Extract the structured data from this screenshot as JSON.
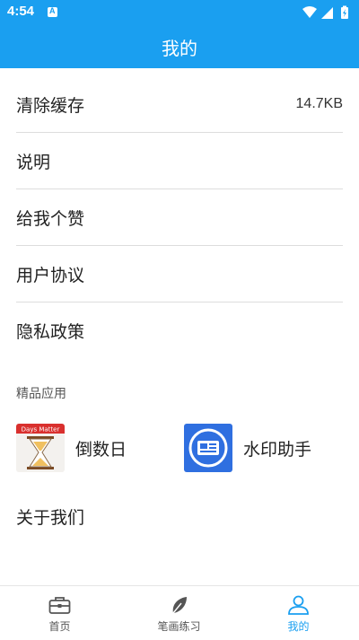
{
  "status_bar": {
    "time": "4:54",
    "notification_icon": "a-icon",
    "system_icons": [
      "wifi-icon",
      "signal-icon",
      "battery-icon"
    ]
  },
  "header": {
    "title": "我的"
  },
  "menu": [
    {
      "label": "清除缓存",
      "value": "14.7KB"
    },
    {
      "label": "说明"
    },
    {
      "label": "给我个赞"
    },
    {
      "label": "用户协议"
    },
    {
      "label": "隐私政策"
    }
  ],
  "featured": {
    "title": "精品应用",
    "apps": [
      {
        "name": "倒数日",
        "icon": "hourglass-icon",
        "icon_text": "Days Matter"
      },
      {
        "name": "水印助手",
        "icon": "watermark-icon"
      }
    ]
  },
  "about": "关于我们",
  "tabs": [
    {
      "label": "首页",
      "icon": "toolbox-icon"
    },
    {
      "label": "笔画练习",
      "icon": "leaf-icon"
    },
    {
      "label": "我的",
      "icon": "person-icon",
      "active": true
    }
  ],
  "colors": {
    "primary": "#1a9ff0",
    "divider": "#dddddd"
  }
}
